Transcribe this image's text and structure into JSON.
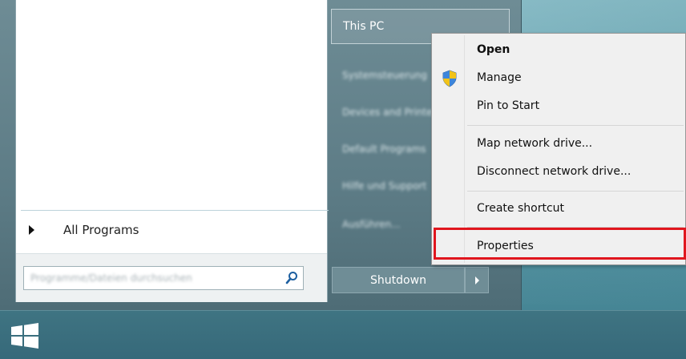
{
  "start_menu": {
    "all_programs_label": "All Programs",
    "search": {
      "placeholder": "Programme/Dateien durchsuchen",
      "icon": "search-icon"
    },
    "right_pane": {
      "this_pc_label": "This PC",
      "items": [
        "Systemsteuerung",
        "Devices and Printers",
        "Default Programs",
        "Hilfe und Support",
        "Ausführen..."
      ],
      "shutdown_label": "Shutdown"
    }
  },
  "context_menu": {
    "items": [
      {
        "label": "Open",
        "bold": true
      },
      {
        "label": "Manage",
        "icon": "uac-shield-icon"
      },
      {
        "label": "Pin to Start"
      },
      {
        "label": "Map network drive..."
      },
      {
        "label": "Disconnect network drive..."
      },
      {
        "label": "Create shortcut"
      },
      {
        "label": "Properties",
        "highlighted": true
      }
    ]
  },
  "colors": {
    "highlight_border": "#e0161e",
    "start_menu_bg": "#5d7c86",
    "taskbar_bg": "#36697a"
  }
}
